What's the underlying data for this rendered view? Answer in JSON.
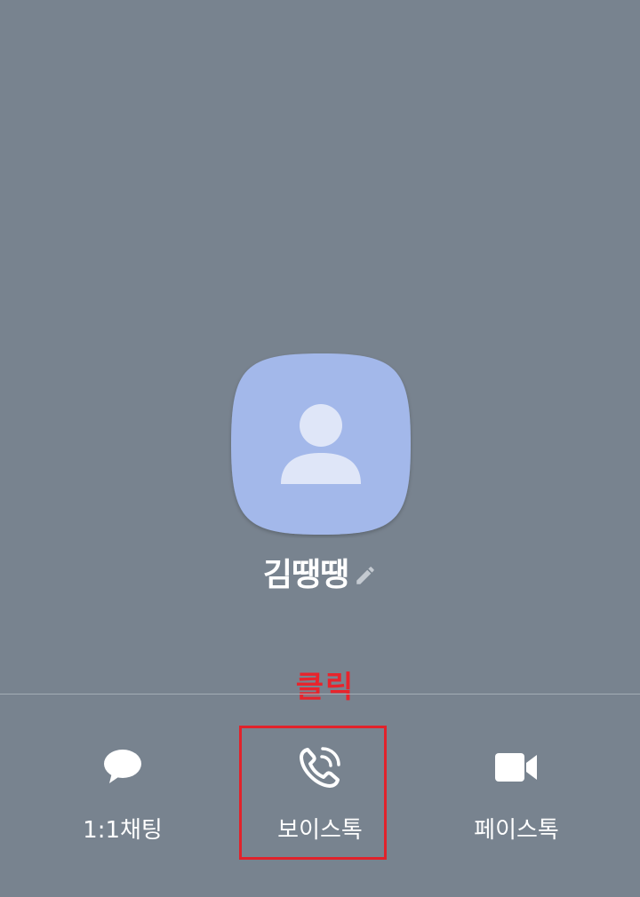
{
  "profile": {
    "name": "김땡땡",
    "avatar_icon": "person-avatar-icon",
    "edit_icon": "pencil-icon"
  },
  "annotation": {
    "text": "클릭",
    "color": "#e1222b"
  },
  "actions": [
    {
      "id": "chat",
      "label": "1:1채팅",
      "icon": "speech-bubble-icon"
    },
    {
      "id": "voice",
      "label": "보이스톡",
      "icon": "phone-icon"
    },
    {
      "id": "face",
      "label": "페이스톡",
      "icon": "video-camera-icon"
    }
  ],
  "colors": {
    "background": "#78838f",
    "avatar_fill": "#a3b8ea",
    "avatar_figure": "#dfe6f8",
    "text": "#ffffff"
  }
}
